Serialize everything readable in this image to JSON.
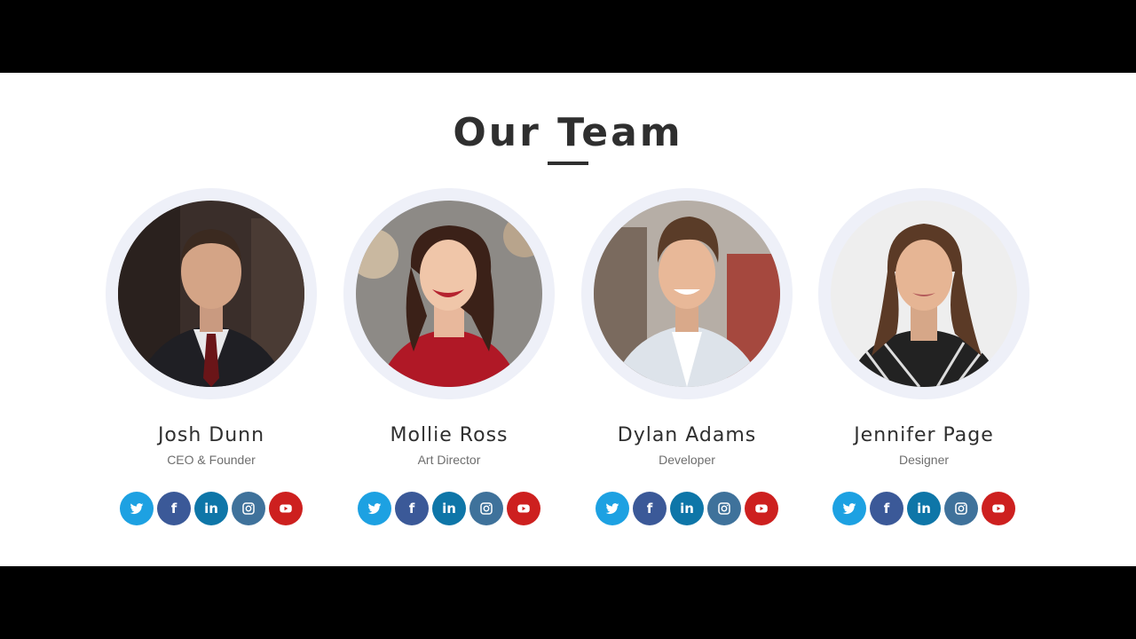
{
  "page": {
    "title": "Our Team"
  },
  "colors": {
    "twitter": "#1da1e2",
    "facebook": "#3b5998",
    "linkedin": "#0e76a8",
    "instagram": "#3f729b",
    "youtube": "#cd201f",
    "ring": "#eef0f8",
    "text": "#2f2f2f"
  },
  "social_icons": [
    "twitter-icon",
    "facebook-icon",
    "linkedin-icon",
    "instagram-icon",
    "youtube-icon"
  ],
  "members": [
    {
      "name": "Josh Dunn",
      "role": "CEO & Founder",
      "photo": "man in dark suit and red tie"
    },
    {
      "name": "Mollie Ross",
      "role": "Art Director",
      "photo": "smiling woman in red top"
    },
    {
      "name": "Dylan Adams",
      "role": "Developer",
      "photo": "smiling man in light blazer"
    },
    {
      "name": "Jennifer Page",
      "role": "Designer",
      "photo": "woman with long brown hair in checked shirt"
    }
  ]
}
